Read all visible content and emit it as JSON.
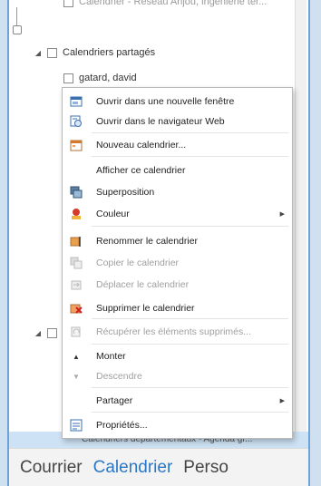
{
  "tree": {
    "top_item": "Calendrier - Réseau Anjou, ingénierie ter...",
    "group_label": "Calendriers partagés",
    "user_item": "gatard, david"
  },
  "context_menu": {
    "items": [
      {
        "label": "Ouvrir dans une nouvelle fenêtre",
        "icon": "new-window-icon",
        "disabled": false
      },
      {
        "label": "Ouvrir dans le navigateur Web",
        "icon": "web-browser-icon",
        "disabled": false
      },
      {
        "label": "Nouveau calendrier...",
        "icon": "new-calendar-icon",
        "disabled": false
      },
      {
        "label": "Afficher ce calendrier",
        "icon": "",
        "disabled": false
      },
      {
        "label": "Superposition",
        "icon": "overlay-icon",
        "disabled": false
      },
      {
        "label": "Couleur",
        "icon": "color-icon",
        "disabled": false,
        "submenu": true
      },
      {
        "label": "Renommer le calendrier",
        "icon": "rename-icon",
        "disabled": false
      },
      {
        "label": "Copier le calendrier",
        "icon": "copy-icon",
        "disabled": true
      },
      {
        "label": "Déplacer le calendrier",
        "icon": "move-icon",
        "disabled": true
      },
      {
        "label": "Supprimer le calendrier",
        "icon": "delete-icon",
        "disabled": false
      },
      {
        "label": "Récupérer les éléments supprimés...",
        "icon": "recover-icon",
        "disabled": true
      },
      {
        "label": "Monter",
        "icon": "move-up-icon",
        "disabled": false
      },
      {
        "label": "Descendre",
        "icon": "move-down-icon",
        "disabled": true
      },
      {
        "label": "Partager",
        "icon": "",
        "disabled": false,
        "submenu": true
      },
      {
        "label": "Propriétés...",
        "icon": "properties-icon",
        "disabled": false
      }
    ]
  },
  "bottom_item": "Calendriers départementaux - Agenda gr...",
  "nav": {
    "mail": "Courrier",
    "calendar": "Calendrier",
    "people": "Perso"
  },
  "colors": {
    "accent": "#2b78c5",
    "frame_border": "#6fa3d8"
  }
}
